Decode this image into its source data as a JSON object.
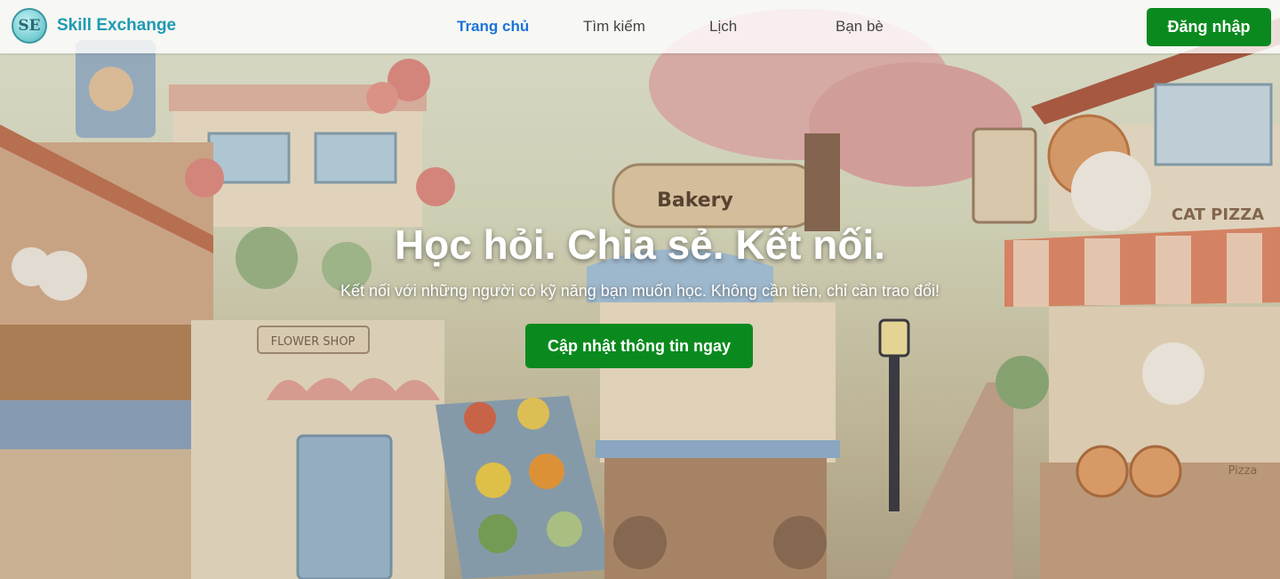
{
  "navbar": {
    "logo_text": "SE",
    "brand_name": "Skill Exchange",
    "links": [
      {
        "label": "Trang chủ",
        "active": true
      },
      {
        "label": "Tìm kiếm",
        "active": false
      },
      {
        "label": "Lịch",
        "active": false
      },
      {
        "label": "Bạn bè",
        "active": false
      }
    ],
    "login_label": "Đăng nhập"
  },
  "hero": {
    "title": "Học hỏi. Chia sẻ. Kết nối.",
    "subtitle": "Kết nối với những người có kỹ năng bạn muốn học. Không cần tiền, chỉ cần trao đổi!",
    "cta_label": "Cập nhật thông tin ngay"
  },
  "background": {
    "signs": {
      "bakery": "Bakery",
      "flower_shop": "FLOWER SHOP",
      "cat_pizza": "CAT PIZZA",
      "pizza_box": "Pizza"
    }
  },
  "colors": {
    "brand": "#1d9bb3",
    "active_link": "#1a74d9",
    "button_green": "#0a8a1e"
  }
}
